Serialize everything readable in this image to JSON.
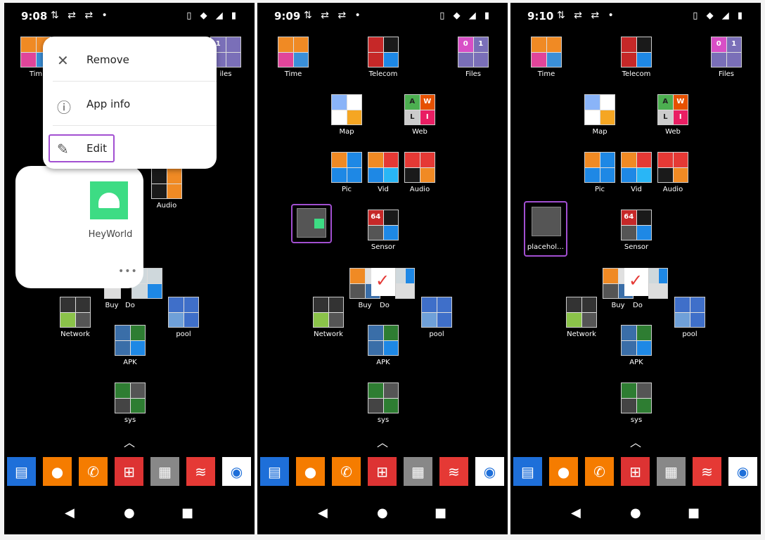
{
  "status_icons": "⇅ ⇄ ⇄ •",
  "status_right": "▯ ◆ ◢ ▮",
  "panels": [
    {
      "time": "9:08"
    },
    {
      "time": "9:09"
    },
    {
      "time": "9:10"
    }
  ],
  "apps": {
    "time": "Time",
    "telecom": "Telecom",
    "files": "Files",
    "map": "Map",
    "web": "Web",
    "pic": "Pic",
    "vid": "Vid",
    "audio": "Audio",
    "sensor": "Sensor",
    "buy": "Buy",
    "do": "Do",
    "network": "Network",
    "pool": "pool",
    "apk": "APK",
    "sys": "sys"
  },
  "menu": {
    "remove": "Remove",
    "app_info": "App info",
    "edit": "Edit"
  },
  "card": {
    "name": "HeyWorld",
    "more": "•••"
  },
  "placeholder_label": "placehol…",
  "partial_labels": {
    "time": "Tim",
    "files": "iles"
  },
  "tile_text": {
    "files": [
      "0",
      "1"
    ],
    "web": [
      "A",
      "W",
      "L",
      "I"
    ],
    "sensor": "64"
  },
  "colors": {
    "accent": "#a24fd1"
  }
}
